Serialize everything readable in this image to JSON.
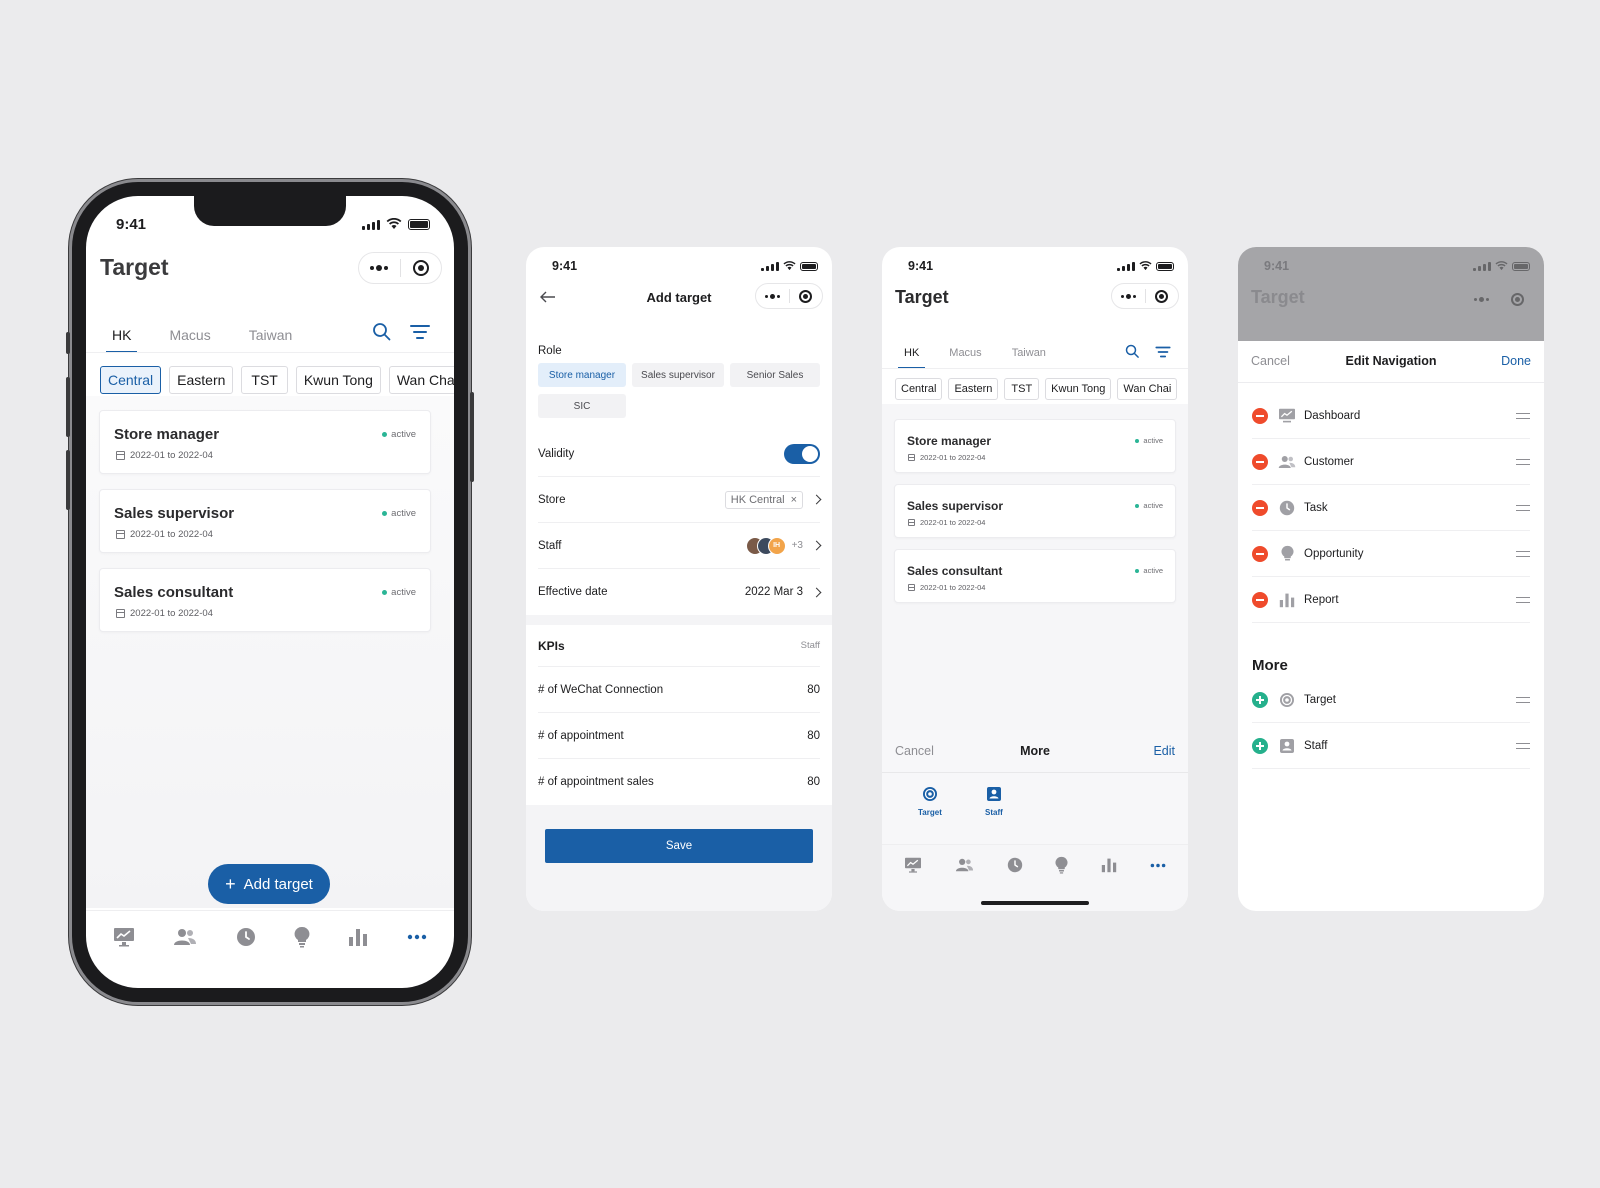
{
  "status": {
    "time": "9:41"
  },
  "target_screen": {
    "title": "Target",
    "tabs": [
      "HK",
      "Macus",
      "Taiwan"
    ],
    "chips": [
      "Central",
      "Eastern",
      "TST",
      "Kwun Tong",
      "Wan Chai"
    ],
    "cards": [
      {
        "title": "Store manager",
        "date": "2022-01 to 2022-04",
        "status": "active"
      },
      {
        "title": "Sales supervisor",
        "date": "2022-01 to 2022-04",
        "status": "active"
      },
      {
        "title": "Sales consultant",
        "date": "2022-01 to 2022-04",
        "status": "active"
      }
    ],
    "add_button": "Add target",
    "tabbar_icons": [
      "dashboard-icon",
      "customer-icon",
      "task-icon",
      "opportunity-icon",
      "report-icon",
      "more-icon"
    ]
  },
  "add_target": {
    "title": "Add target",
    "role_label": "Role",
    "roles": [
      "Store manager",
      "Sales supervisor",
      "Senior Sales",
      "SIC"
    ],
    "validity_label": "Validity",
    "validity_on": true,
    "store_label": "Store",
    "store_value": "HK Central",
    "staff_label": "Staff",
    "staff_avatar_initials": "IH",
    "staff_extra": "+3",
    "effective_label": "Effective date",
    "effective_value": "2022 Mar 3",
    "kpis_label": "KPIs",
    "kpis_right": "Staff",
    "kpis": [
      {
        "label": "# of WeChat Connection",
        "value": "80"
      },
      {
        "label": "# of appointment",
        "value": "80"
      },
      {
        "label": "# of appointment sales",
        "value": "80"
      }
    ],
    "save": "Save"
  },
  "more_sheet": {
    "cancel": "Cancel",
    "title": "More",
    "edit": "Edit",
    "items": [
      {
        "label": "Target",
        "icon": "target-icon"
      },
      {
        "label": "Staff",
        "icon": "staff-icon"
      }
    ]
  },
  "edit_nav": {
    "cancel": "Cancel",
    "title": "Edit Navigation",
    "done": "Done",
    "items": [
      {
        "label": "Dashboard",
        "icon": "dashboard-icon"
      },
      {
        "label": "Customer",
        "icon": "customer-icon"
      },
      {
        "label": "Task",
        "icon": "task-icon"
      },
      {
        "label": "Opportunity",
        "icon": "opportunity-icon"
      },
      {
        "label": "Report",
        "icon": "report-icon"
      }
    ],
    "more_title": "More",
    "more_items": [
      {
        "label": "Target",
        "icon": "target-icon"
      },
      {
        "label": "Staff",
        "icon": "staff-icon"
      }
    ]
  },
  "colors": {
    "accent": "#1a5fa6",
    "active_dot": "#2bb596",
    "remove": "#ef4b2c",
    "add": "#25b08c"
  }
}
